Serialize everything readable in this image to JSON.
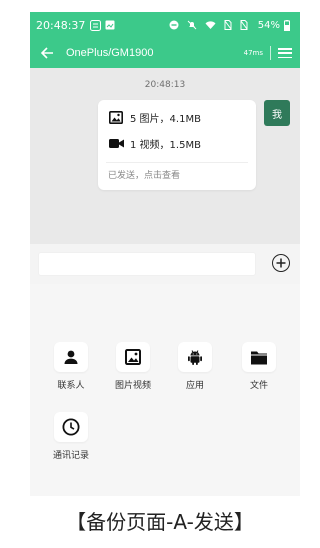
{
  "status_bar": {
    "time": "20:48:37",
    "battery_percent": "54%"
  },
  "app_bar": {
    "title": "OnePlus/GM1900",
    "speed": "47ms"
  },
  "chat": {
    "timestamp": "20:48:13",
    "message": {
      "images_line": "5 图片，4.1MB",
      "videos_line": "1 视频，1.5MB",
      "status": "已发送，点击查看"
    },
    "avatar_label": "我"
  },
  "tools": [
    {
      "label": "联系人",
      "icon": "person-icon"
    },
    {
      "label": "图片视频",
      "icon": "image-icon"
    },
    {
      "label": "应用",
      "icon": "android-icon"
    },
    {
      "label": "文件",
      "icon": "folder-icon"
    },
    {
      "label": "通讯记录",
      "icon": "clock-icon"
    }
  ],
  "caption": "【备份页面-A-发送】",
  "colors": {
    "accent": "#3cc98a",
    "avatar": "#2f7a5a"
  }
}
